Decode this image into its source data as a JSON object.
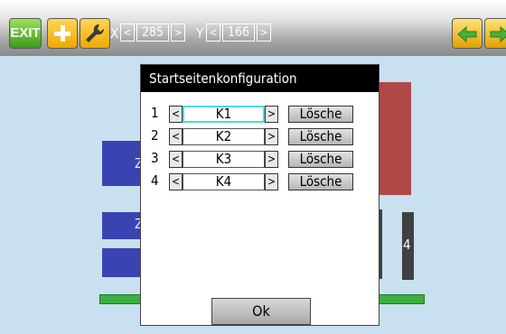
{
  "toolbar": {
    "exit_label": "EXIT",
    "x_label": "X",
    "x_value": "285",
    "y_label": "Y",
    "y_value": "166",
    "dec_arrow": "<",
    "inc_arrow": ">"
  },
  "background": {
    "widget_labels": [
      "Z",
      "Z",
      "4"
    ]
  },
  "dialog": {
    "title": "Startseitenkonfiguration",
    "rows": [
      {
        "num": "1",
        "value": "K1",
        "delete_label": "Lösche",
        "active": true
      },
      {
        "num": "2",
        "value": "K2",
        "delete_label": "Lösche",
        "active": false
      },
      {
        "num": "3",
        "value": "K3",
        "delete_label": "Lösche",
        "active": false
      },
      {
        "num": "4",
        "value": "K4",
        "delete_label": "Lösche",
        "active": false
      }
    ],
    "arrow_left": "<",
    "arrow_right": ">",
    "ok_label": "Ok"
  },
  "colors": {
    "background": "#c8e0f0",
    "widget_blue": "#3a44b0",
    "widget_red": "#b04848",
    "widget_green": "#3ab040",
    "widget_dark": "#404040",
    "selection_highlight": "#4fd8e0"
  },
  "icons": [
    "plus-icon",
    "wrench-icon",
    "arrow-left-icon",
    "arrow-right-icon"
  ]
}
